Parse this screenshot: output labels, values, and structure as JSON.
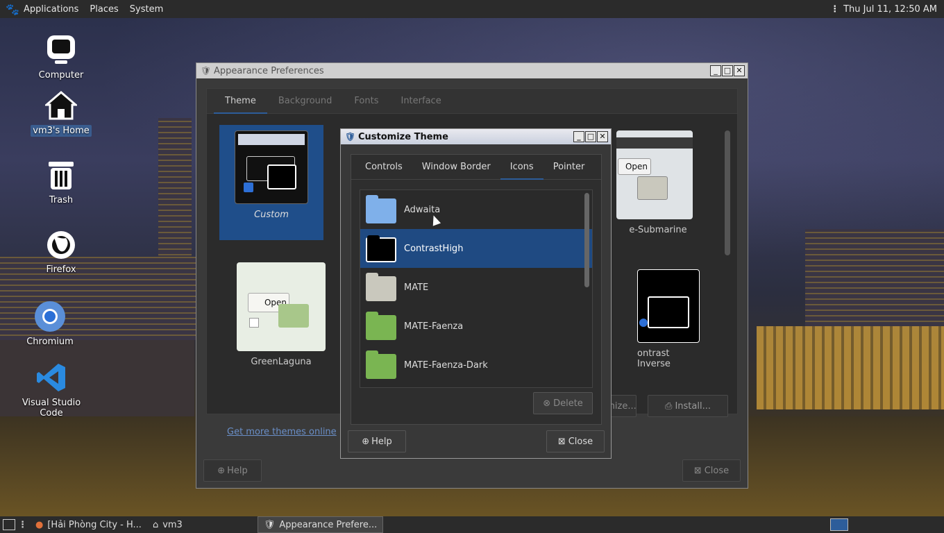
{
  "top_panel": {
    "menus": [
      "Applications",
      "Places",
      "System"
    ],
    "clock": "Thu Jul 11, 12:50 AM"
  },
  "desktop_icons": [
    {
      "label": "Computer",
      "icon": "computer-icon"
    },
    {
      "label": "vm3's Home",
      "icon": "home-icon",
      "selected": true
    },
    {
      "label": "Trash",
      "icon": "trash-icon"
    },
    {
      "label": "Firefox",
      "icon": "firefox-icon"
    },
    {
      "label": "Chromium",
      "icon": "chromium-icon"
    },
    {
      "label": "Visual Studio Code",
      "icon": "vscode-icon"
    }
  ],
  "appearance": {
    "title": "Appearance Preferences",
    "tabs": [
      "Theme",
      "Background",
      "Fonts",
      "Interface"
    ],
    "active_tab": "Theme",
    "themes": [
      {
        "name": "Custom",
        "selected": true
      },
      {
        "name": "GreenLaguna"
      },
      {
        "name": "e-Submarine"
      },
      {
        "name": "ontrast Inverse"
      }
    ],
    "customize_label": "mize...",
    "install_label": "Install...",
    "link": "Get more themes online",
    "help_label": "Help",
    "close_label": "Close"
  },
  "customize": {
    "title": "Customize Theme",
    "tabs": [
      "Controls",
      "Window Border",
      "Icons",
      "Pointer"
    ],
    "active_tab": "Icons",
    "icon_themes": [
      {
        "name": "Adwaita",
        "color": "#7fb0ea"
      },
      {
        "name": "ContrastHigh",
        "color": "#000000",
        "selected": true
      },
      {
        "name": "MATE",
        "color": "#c9c8bd"
      },
      {
        "name": "MATE-Faenza",
        "color": "#7ab552"
      },
      {
        "name": "MATE-Faenza-Dark",
        "color": "#7ab552"
      }
    ],
    "delete_label": "Delete",
    "help_label": "Help",
    "close_label": "Close"
  },
  "thumb_open_label": "Open",
  "taskbar": {
    "items": [
      {
        "label": "[Hải Phòng City - H...",
        "icon": "firefox-icon"
      },
      {
        "label": "vm3",
        "icon": "home-icon"
      },
      {
        "label": "Appearance Prefere...",
        "icon": "appearance-icon",
        "active": true
      }
    ]
  }
}
